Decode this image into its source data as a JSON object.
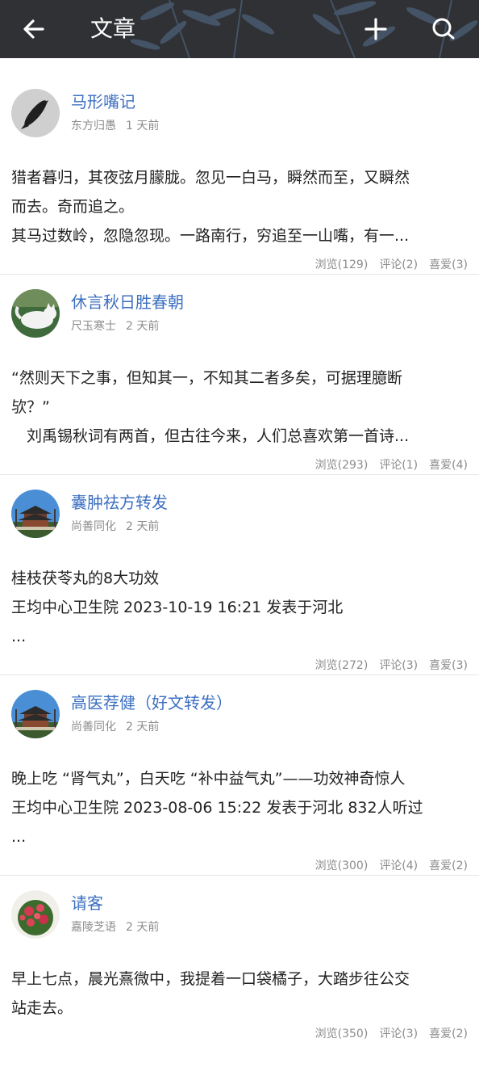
{
  "header": {
    "title": "文章",
    "back_icon": "arrow-left-icon",
    "add_icon": "plus-icon",
    "search_icon": "search-icon",
    "bg_color": "#2f3134"
  },
  "articles": [
    {
      "title": "马形嘴记",
      "author": "东方归愚",
      "time": "1 天前",
      "lines": [
        "猎者暮归，其夜弦月朦胧。忽见一白马，瞬然而至，又瞬然",
        "而去。奇而追之。",
        "其马过数岭，忽隐忽现。一路南行，穷追至一山嘴，有一..."
      ],
      "views": "浏览(129)",
      "comments": "评论(2)",
      "likes": "喜爱(3)",
      "avatar": "bird-avatar"
    },
    {
      "title": "休言秋日胜春朝",
      "author": "尺玉寒士",
      "time": "2 天前",
      "lines": [
        "“然则天下之事，但知其一，不知其二者多矣，可据理臆断",
        "欤？”",
        "　刘禹锡秋词有两首，但古往今来，人们总喜欢第一首诗..."
      ],
      "views": "浏览(293)",
      "comments": "评论(1)",
      "likes": "喜爱(4)",
      "avatar": "cat-avatar"
    },
    {
      "title": "囊肿祛方转发",
      "author": "尚善同化",
      "time": "2 天前",
      "lines": [
        "桂枝茯苓丸的8大功效",
        "王均中心卫生院 2023-10-19 16:21 发表于河北",
        "..."
      ],
      "views": "浏览(272)",
      "comments": "评论(3)",
      "likes": "喜爱(3)",
      "avatar": "pagoda-avatar"
    },
    {
      "title": "高医荐健（好文转发）",
      "author": "尚善同化",
      "time": "2 天前",
      "lines": [
        "晚上吃 “肾气丸”，白天吃 “补中益气丸”——功效神奇惊人",
        "王均中心卫生院 2023-08-06 15:22 发表于河北 832人听过",
        "..."
      ],
      "views": "浏览(300)",
      "comments": "评论(4)",
      "likes": "喜爱(2)",
      "avatar": "pagoda-avatar"
    },
    {
      "title": "请客",
      "author": "嘉陵芝语",
      "time": "2 天前",
      "lines": [
        "早上七点，晨光熹微中，我提着一口袋橘子，大踏步往公交",
        "站走去。",
        ""
      ],
      "views": "浏览(350)",
      "comments": "评论(3)",
      "likes": "喜爱(2)",
      "avatar": "flower-avatar"
    }
  ]
}
